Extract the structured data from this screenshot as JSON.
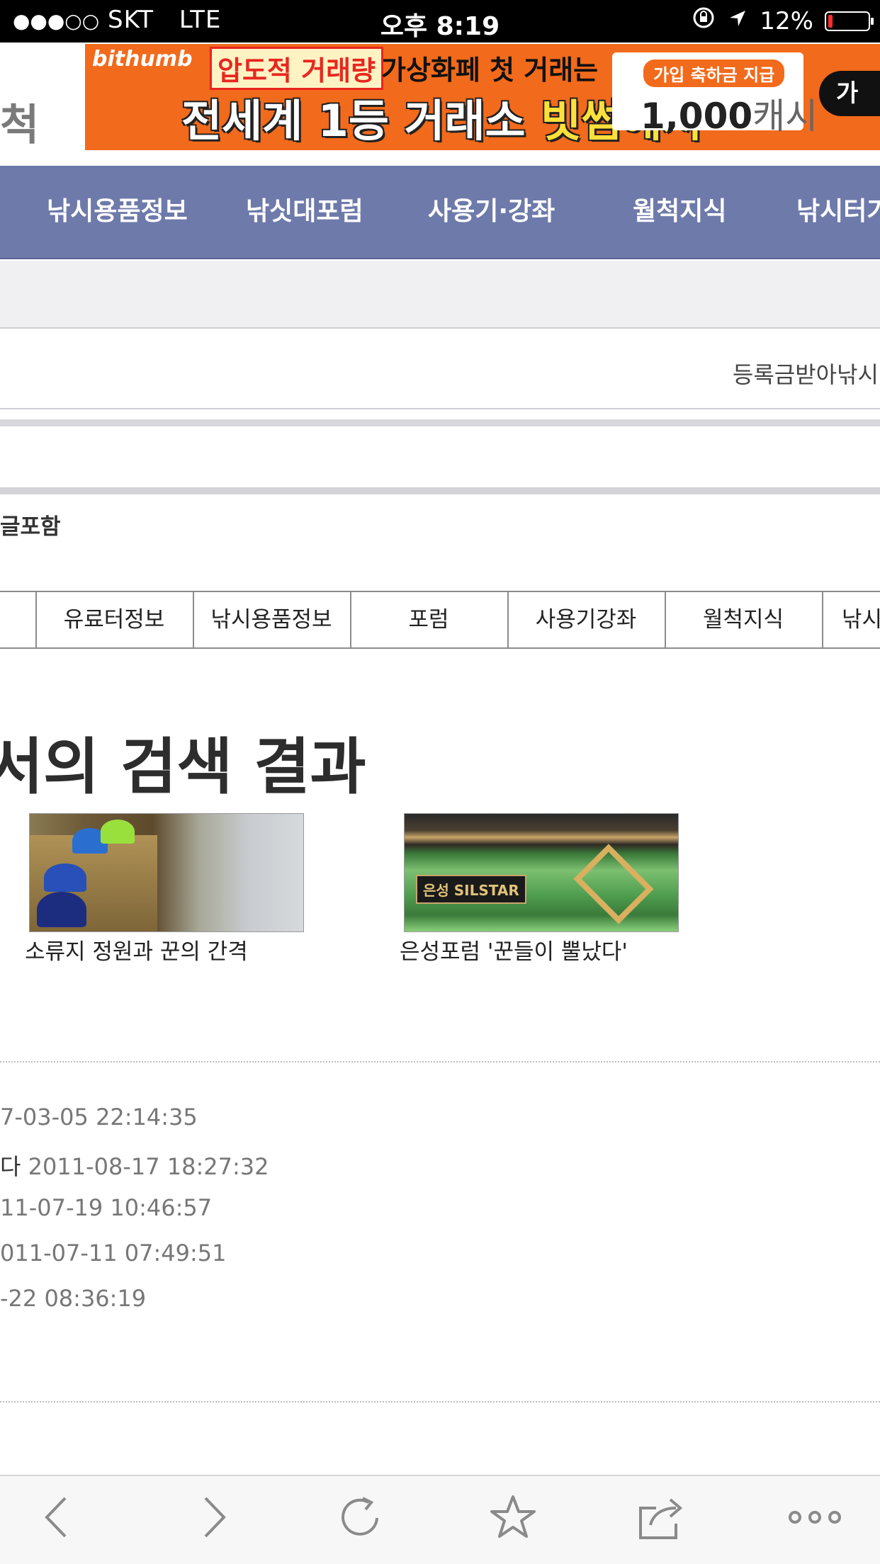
{
  "status_bar": {
    "carrier": "SKT",
    "signal": "●●●○○",
    "network": "LTE",
    "time": "오후 8:19",
    "battery_percent": "12%",
    "battery_level": 0.12
  },
  "header": {
    "logo_fragment": "척"
  },
  "ad_banner": {
    "brand": "bithumb",
    "headline_box": "압도적 거래량",
    "headline_rest": "가상화페 첫 거래는",
    "main_text_a": "전세계 1등 거래소 ",
    "main_text_b": "빗썸에서",
    "card_tag": "가입 축하금 지급",
    "card_amount": "1,000",
    "card_unit": "캐시",
    "join_label": "가"
  },
  "main_nav": {
    "items": [
      "낚시용품정보",
      "낚싯대포럼",
      "사용기·강좌",
      "월척지식",
      "낚시터가"
    ]
  },
  "ticker_text": "등록금받아낚시",
  "include_text": "글포함",
  "category_tabs": [
    "",
    "유료터정보",
    "낚시용품정보",
    "포럼",
    "사용기강좌",
    "월척지식",
    "낚시"
  ],
  "results_title": "서의 검색 결과",
  "thumbnails": [
    {
      "caption": "소류지 정원과 꾼의 간격",
      "icon": "fishing-photo"
    },
    {
      "caption": "은성포럼 '꾼들이 뿔났다'",
      "icon": "silstar-rod-banner",
      "badge": "은성 SILSTAR"
    }
  ],
  "list_rows": [
    {
      "prefix": "",
      "date": "7-03-05 22:14:35"
    },
    {
      "prefix": "다 ",
      "date": "2011-08-17 18:27:32"
    },
    {
      "prefix": "",
      "date": "11-07-19 10:46:57"
    },
    {
      "prefix": "",
      "date": "011-07-11 07:49:51"
    },
    {
      "prefix": "",
      "date": "-22 08:36:19"
    }
  ],
  "toolbar": {
    "icons": [
      "back-icon",
      "forward-icon",
      "reload-icon",
      "bookmark-star-icon",
      "share-icon",
      "more-icon"
    ]
  },
  "colors": {
    "nav_bg": "#6e7aaa",
    "ad_bg": "#f26a1b",
    "status_bg": "#000000"
  }
}
